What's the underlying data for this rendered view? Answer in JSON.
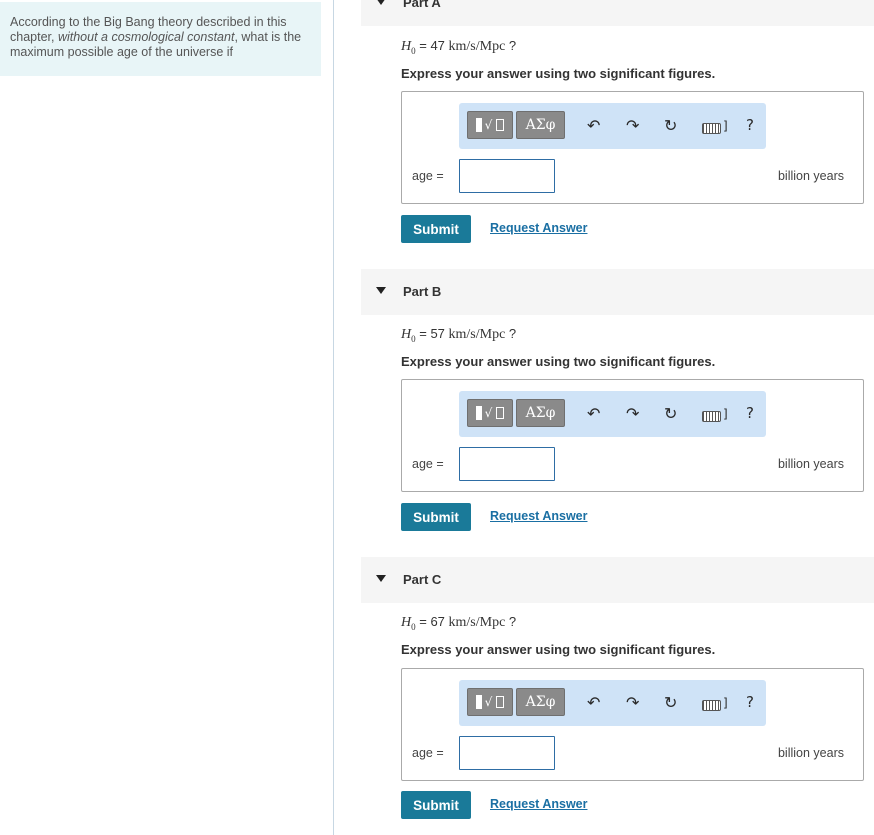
{
  "problem": {
    "text_before": "According to the Big Bang theory described in this chapter, ",
    "text_italic": "without a cosmological constant",
    "text_after": ", what is the maximum possible age of the universe if"
  },
  "parts": [
    {
      "title": "Part A",
      "question_symbol": "H",
      "question_subscript": "0",
      "question_equals": " = 47 ",
      "question_unit": "km/s/Mpc",
      "question_mark": " ?",
      "instruction": "Express your answer using two significant figures.",
      "answer_label": "age =",
      "answer_value": "",
      "units": "billion years",
      "submit_label": "Submit",
      "request_label": "Request Answer"
    },
    {
      "title": "Part B",
      "question_symbol": "H",
      "question_subscript": "0",
      "question_equals": " = 57 ",
      "question_unit": "km/s/Mpc",
      "question_mark": " ?",
      "instruction": "Express your answer using two significant figures.",
      "answer_label": "age =",
      "answer_value": "",
      "units": "billion years",
      "submit_label": "Submit",
      "request_label": "Request Answer"
    },
    {
      "title": "Part C",
      "question_symbol": "H",
      "question_subscript": "0",
      "question_equals": " = 67 ",
      "question_unit": "km/s/Mpc",
      "question_mark": " ?",
      "instruction": "Express your answer using two significant figures.",
      "answer_label": "age =",
      "answer_value": "",
      "units": "billion years",
      "submit_label": "Submit",
      "request_label": "Request Answer"
    }
  ],
  "toolbar": {
    "templates_glyph": "√",
    "greek_label": "ΑΣφ",
    "undo_glyph": "↶",
    "redo_glyph": "↷",
    "reset_glyph": "↻",
    "keyboard_bracket": "]",
    "help_glyph": "?"
  },
  "colors": {
    "submit_bg": "#1a7a99",
    "link": "#1a6fa3",
    "toolbar_bg": "#cfe3f7",
    "problem_bg": "#e8f5f7"
  }
}
